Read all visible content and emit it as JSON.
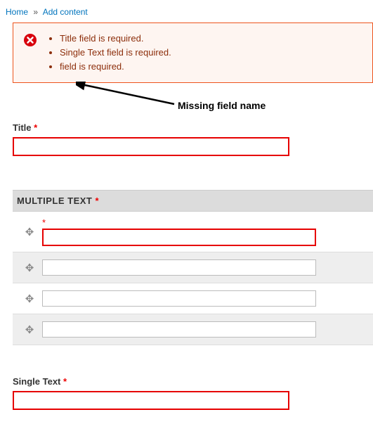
{
  "breadcrumb": {
    "home": "Home",
    "sep": "»",
    "add_content": "Add content"
  },
  "error_box": {
    "messages": [
      "Title field is required.",
      "Single Text field is required.",
      "field is required."
    ]
  },
  "annotation": {
    "text": "Missing field name"
  },
  "title_field": {
    "label": "Title",
    "value": ""
  },
  "multi": {
    "header": "MULTIPLE TEXT",
    "rows": [
      {
        "required": true,
        "error": true,
        "value": "",
        "alt": false
      },
      {
        "required": false,
        "error": false,
        "value": "",
        "alt": true
      },
      {
        "required": false,
        "error": false,
        "value": "",
        "alt": false
      },
      {
        "required": false,
        "error": false,
        "value": "",
        "alt": true
      }
    ]
  },
  "single_field": {
    "label": "Single Text",
    "value": ""
  },
  "required_mark": "*"
}
